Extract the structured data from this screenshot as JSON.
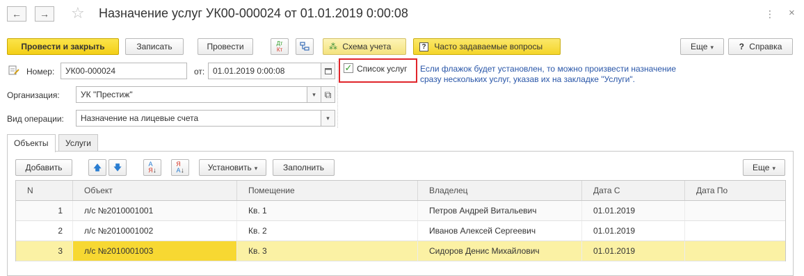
{
  "window": {
    "title": "Назначение услуг УК00-000024 от 01.01.2019 0:00:08",
    "back_icon": "←",
    "forward_icon": "→",
    "star_icon": "☆",
    "more_icon": "⋮",
    "close_icon": "×"
  },
  "toolbar": {
    "post_close_label": "Провести и закрыть",
    "write_label": "Записать",
    "post_label": "Провести",
    "dt_kt_label_top": "Дт",
    "dt_kt_label_bottom": "Кт",
    "scheme_label": "Схема учета",
    "faq_label": "Часто задаваемые вопросы",
    "more_label": "Еще",
    "help_label": "Справка",
    "help_icon": "?"
  },
  "header": {
    "number_label": "Номер:",
    "number_value": "УК00-000024",
    "date_label": "от:",
    "date_value": "01.01.2019  0:00:08",
    "org_label": "Организация:",
    "org_value": "УК \"Престиж\"",
    "op_label": "Вид операции:",
    "op_value": "Назначение на лицевые счета",
    "services_checkbox_label": "Список услуг",
    "services_checked": true,
    "hint_line1": "Если флажок будет установлен, то можно произвести назначение",
    "hint_line2": "сразу нескольких услуг, указав их на закладке \"Услуги\"."
  },
  "tabs": [
    {
      "label": "Объекты",
      "active": true
    },
    {
      "label": "Услуги",
      "active": false
    }
  ],
  "table_toolbar": {
    "add_label": "Добавить",
    "set_label": "Установить",
    "fill_label": "Заполнить",
    "more_label": "Еще"
  },
  "table": {
    "columns": [
      "N",
      "Объект",
      "Помещение",
      "Владелец",
      "Дата С",
      "Дата По"
    ],
    "rows": [
      {
        "n": "1",
        "object": "л/с №2010001001",
        "room": "Кв. 1",
        "owner": "Петров Андрей Витальевич",
        "date_from": "01.01.2019",
        "date_to": ""
      },
      {
        "n": "2",
        "object": "л/с №2010001002",
        "room": "Кв. 2",
        "owner": "Иванов Алексей Сергеевич",
        "date_from": "01.01.2019",
        "date_to": ""
      },
      {
        "n": "3",
        "object": "л/с №2010001003",
        "room": "Кв. 3",
        "owner": "Сидоров Денис Михайлович",
        "date_from": "01.01.2019",
        "date_to": ""
      }
    ],
    "selected_row": 3
  },
  "colors": {
    "primary_button": "#f3cf17",
    "selected_row": "#fbf1a4",
    "selected_cell": "#f7d832",
    "highlight_border": "#e0242a",
    "hint_text": "#2956a8",
    "checkmark": "#2f9d27"
  }
}
